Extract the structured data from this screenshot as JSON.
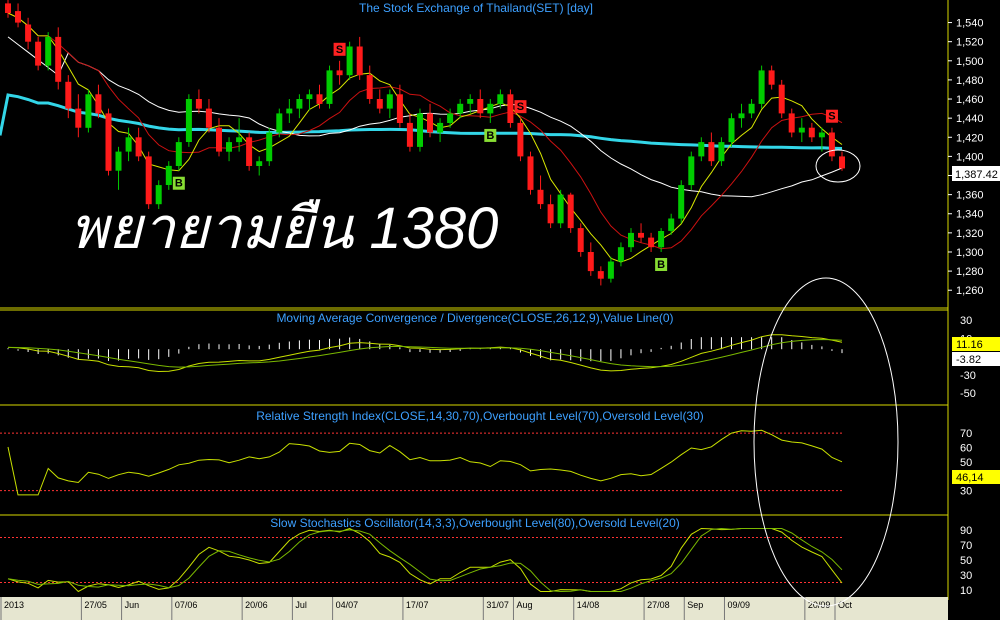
{
  "chart_data": {
    "type": "candlestick",
    "title": "The Stock Exchange of Thailand(SET) [day]",
    "annotation": "พยายามยืน 1380",
    "last_price_label": "1,387.42",
    "price_axis": {
      "ticks": [
        "1,540",
        "1,520",
        "1,500",
        "1,480",
        "1,460",
        "1,440",
        "1,420",
        "1,400",
        "1,380",
        "1,360",
        "1,340",
        "1,320",
        "1,300",
        "1,280",
        "1,260"
      ],
      "ylim": [
        1255,
        1550
      ]
    },
    "dates": [
      "2013",
      "27/05",
      "Jun",
      "07/06",
      "20/06",
      "Jul",
      "04/07",
      "17/07",
      "31/07",
      "Aug",
      "14/08",
      "27/08",
      "Sep",
      "09/09",
      "20/09",
      "Oct"
    ],
    "candles": [
      [
        1560,
        1565,
        1545,
        1550
      ],
      [
        1552,
        1560,
        1535,
        1540
      ],
      [
        1538,
        1545,
        1512,
        1520
      ],
      [
        1520,
        1525,
        1490,
        1495
      ],
      [
        1495,
        1530,
        1490,
        1525
      ],
      [
        1525,
        1535,
        1470,
        1478
      ],
      [
        1478,
        1485,
        1440,
        1450
      ],
      [
        1450,
        1465,
        1420,
        1430
      ],
      [
        1430,
        1470,
        1425,
        1465
      ],
      [
        1465,
        1475,
        1440,
        1445
      ],
      [
        1445,
        1450,
        1380,
        1385
      ],
      [
        1385,
        1410,
        1365,
        1405
      ],
      [
        1405,
        1430,
        1395,
        1420
      ],
      [
        1420,
        1430,
        1395,
        1400
      ],
      [
        1400,
        1405,
        1345,
        1350
      ],
      [
        1350,
        1375,
        1345,
        1370
      ],
      [
        1370,
        1395,
        1365,
        1390
      ],
      [
        1390,
        1420,
        1385,
        1415
      ],
      [
        1415,
        1465,
        1410,
        1460
      ],
      [
        1460,
        1470,
        1445,
        1450
      ],
      [
        1450,
        1460,
        1425,
        1430
      ],
      [
        1430,
        1440,
        1400,
        1405
      ],
      [
        1405,
        1420,
        1395,
        1415
      ],
      [
        1415,
        1440,
        1405,
        1420
      ],
      [
        1420,
        1425,
        1385,
        1390
      ],
      [
        1390,
        1400,
        1380,
        1395
      ],
      [
        1395,
        1430,
        1390,
        1425
      ],
      [
        1425,
        1450,
        1420,
        1445
      ],
      [
        1445,
        1460,
        1435,
        1450
      ],
      [
        1450,
        1465,
        1440,
        1460
      ],
      [
        1460,
        1470,
        1448,
        1465
      ],
      [
        1465,
        1475,
        1450,
        1455
      ],
      [
        1455,
        1495,
        1450,
        1490
      ],
      [
        1490,
        1500,
        1475,
        1485
      ],
      [
        1485,
        1520,
        1480,
        1515
      ],
      [
        1515,
        1525,
        1480,
        1485
      ],
      [
        1485,
        1495,
        1455,
        1460
      ],
      [
        1460,
        1470,
        1445,
        1450
      ],
      [
        1450,
        1470,
        1440,
        1465
      ],
      [
        1465,
        1475,
        1430,
        1435
      ],
      [
        1435,
        1445,
        1405,
        1410
      ],
      [
        1410,
        1450,
        1405,
        1445
      ],
      [
        1445,
        1455,
        1420,
        1425
      ],
      [
        1425,
        1440,
        1415,
        1435
      ],
      [
        1435,
        1450,
        1430,
        1445
      ],
      [
        1445,
        1460,
        1440,
        1455
      ],
      [
        1455,
        1465,
        1445,
        1460
      ],
      [
        1460,
        1470,
        1440,
        1445
      ],
      [
        1445,
        1460,
        1435,
        1455
      ],
      [
        1455,
        1470,
        1450,
        1465
      ],
      [
        1465,
        1470,
        1430,
        1435
      ],
      [
        1435,
        1440,
        1395,
        1400
      ],
      [
        1400,
        1405,
        1360,
        1365
      ],
      [
        1365,
        1380,
        1345,
        1350
      ],
      [
        1350,
        1360,
        1325,
        1330
      ],
      [
        1330,
        1365,
        1325,
        1360
      ],
      [
        1360,
        1362,
        1320,
        1325
      ],
      [
        1325,
        1330,
        1295,
        1300
      ],
      [
        1300,
        1310,
        1275,
        1280
      ],
      [
        1280,
        1285,
        1265,
        1272
      ],
      [
        1272,
        1295,
        1268,
        1290
      ],
      [
        1290,
        1310,
        1285,
        1305
      ],
      [
        1305,
        1325,
        1300,
        1320
      ],
      [
        1320,
        1330,
        1310,
        1315
      ],
      [
        1315,
        1320,
        1300,
        1305
      ],
      [
        1305,
        1325,
        1300,
        1322
      ],
      [
        1322,
        1340,
        1318,
        1335
      ],
      [
        1335,
        1375,
        1330,
        1370
      ],
      [
        1370,
        1405,
        1365,
        1400
      ],
      [
        1400,
        1420,
        1395,
        1415
      ],
      [
        1415,
        1425,
        1390,
        1395
      ],
      [
        1395,
        1420,
        1390,
        1415
      ],
      [
        1415,
        1445,
        1410,
        1440
      ],
      [
        1440,
        1455,
        1430,
        1445
      ],
      [
        1445,
        1460,
        1440,
        1455
      ],
      [
        1455,
        1495,
        1450,
        1490
      ],
      [
        1490,
        1495,
        1470,
        1475
      ],
      [
        1475,
        1480,
        1440,
        1445
      ],
      [
        1445,
        1450,
        1420,
        1425
      ],
      [
        1425,
        1440,
        1415,
        1430
      ],
      [
        1430,
        1435,
        1415,
        1420
      ],
      [
        1420,
        1430,
        1405,
        1425
      ],
      [
        1425,
        1430,
        1395,
        1400
      ],
      [
        1400,
        1405,
        1385,
        1387.42
      ]
    ],
    "signals": [
      {
        "index": 17,
        "label": "B"
      },
      {
        "index": 33,
        "label": "S"
      },
      {
        "index": 48,
        "label": "B"
      },
      {
        "index": 51,
        "label": "S"
      },
      {
        "index": 65,
        "label": "B"
      },
      {
        "index": 82,
        "label": "S"
      }
    ],
    "macd": {
      "title": "Moving Average Convergence / Divergence(CLOSE,26,12,9),Value Line(0)",
      "ticks": [
        "30",
        "10",
        "-10",
        "-30",
        "-50"
      ],
      "macd_value": "11.16",
      "signal_value": "-3.82"
    },
    "rsi": {
      "title": "Relative Strength Index(CLOSE,14,30,70),Overbought Level(70),Oversold Level(30)",
      "ticks": [
        "70",
        "60",
        "50",
        "40",
        "30"
      ],
      "value": "46,14"
    },
    "stoch": {
      "title": "Slow Stochastics Oscillator(14,3,3),Overbought Level(80),Oversold Level(20)",
      "ticks": [
        "90",
        "70",
        "50",
        "30",
        "10"
      ]
    },
    "colors": {
      "up": "#00cc00",
      "down": "#ff1a1a",
      "ma_fast": "#d8e800",
      "ma_mid": "#cc1111",
      "ma_slow": "#ffffff",
      "ma_long": "#33d6e8",
      "ind_a": "#c8e000",
      "ind_b": "#7ab800",
      "panel_border": "#d8d800"
    }
  }
}
